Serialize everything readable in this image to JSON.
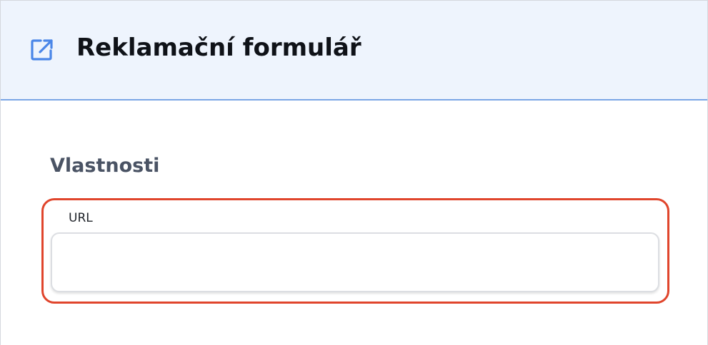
{
  "header": {
    "icon": "external-link-icon",
    "title": "Reklamační formulář"
  },
  "section": {
    "title": "Vlastnosti"
  },
  "url_field": {
    "label": "URL",
    "value": "",
    "placeholder": ""
  },
  "colors": {
    "header_background": "#eef4fd",
    "header_border": "#7aa5e6",
    "icon_color": "#4a86e8",
    "highlight_border": "#e0452c",
    "section_title": "#4a5364"
  }
}
